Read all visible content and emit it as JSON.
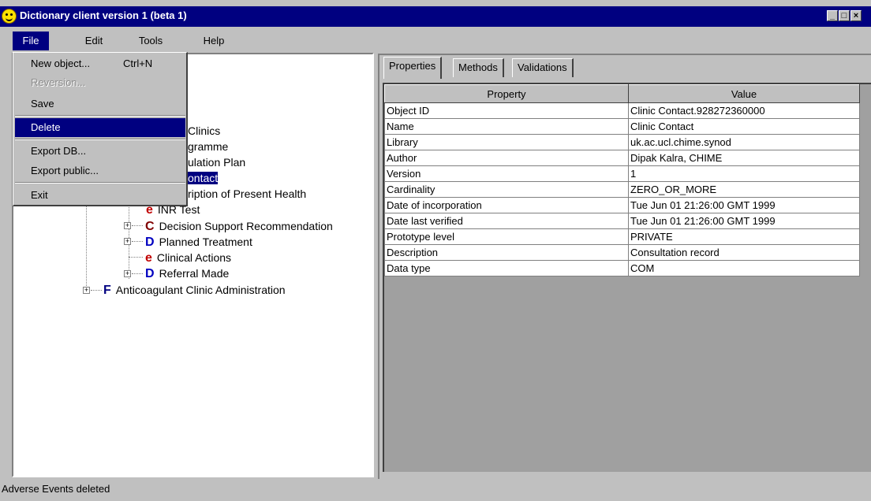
{
  "window": {
    "title": "Dictionary client version 1 (beta 1)"
  },
  "menubar": {
    "items": [
      "File",
      "Edit",
      "Tools",
      "Help"
    ]
  },
  "file_menu": {
    "items": [
      {
        "label": "New object...",
        "accel": "Ctrl+N",
        "disabled": false
      },
      {
        "label": "Reversion...",
        "accel": "",
        "disabled": true
      },
      {
        "label": "Save",
        "accel": "",
        "disabled": false
      },
      {
        "label": "Delete",
        "accel": "",
        "disabled": false,
        "highlighted": true
      },
      {
        "label": "Export DB...",
        "accel": "",
        "disabled": false
      },
      {
        "label": "Export public...",
        "accel": "",
        "disabled": false
      },
      {
        "label": "Exit",
        "accel": "",
        "disabled": false
      }
    ]
  },
  "tree": {
    "visible_fragments": [
      "Clinics",
      "gramme",
      "ulation Plan",
      "ontact",
      "ription of Present Health",
      "INR Test"
    ],
    "nodes": [
      {
        "letter": "C",
        "label": "Decision Support Recommendation",
        "color": "#800000"
      },
      {
        "letter": "D",
        "label": "Planned Treatment",
        "color": "#0000c0"
      },
      {
        "letter": "e",
        "label": "Clinical Actions",
        "color": "#c00000"
      },
      {
        "letter": "D",
        "label": "Referral Made",
        "color": "#0000c0"
      },
      {
        "letter": "F",
        "label": "Anticoagulant Clinic Administration",
        "color": "#000080"
      }
    ]
  },
  "tabs": [
    "Properties",
    "Methods",
    "Validations"
  ],
  "properties_table": {
    "columns": [
      "Property",
      "Value"
    ],
    "rows": [
      [
        "Object ID",
        "Clinic Contact.928272360000"
      ],
      [
        "Name",
        "Clinic Contact"
      ],
      [
        "Library",
        "uk.ac.ucl.chime.synod"
      ],
      [
        "Author",
        "Dipak Kalra, CHIME"
      ],
      [
        "Version",
        "1"
      ],
      [
        "Cardinality",
        "ZERO_OR_MORE"
      ],
      [
        "Date of incorporation",
        "Tue Jun 01 21:26:00 GMT 1999"
      ],
      [
        "Date last verified",
        "Tue Jun 01 21:26:00 GMT 1999"
      ],
      [
        "Prototype level",
        "PRIVATE"
      ],
      [
        "Description",
        "Consultation record"
      ],
      [
        "Data type",
        "COM"
      ]
    ]
  },
  "status": {
    "text": "Adverse Events deleted"
  }
}
